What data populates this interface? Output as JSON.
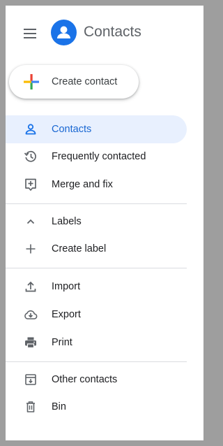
{
  "header": {
    "menu_icon": "hamburger-menu-icon",
    "logo_icon": "contacts-person-icon",
    "title": "Contacts"
  },
  "create_contact": {
    "label": "Create contact",
    "icon": "multicolor-plus-icon"
  },
  "nav": {
    "contacts": {
      "label": "Contacts",
      "icon": "person-outline-icon",
      "active": true
    },
    "frequently_contacted": {
      "label": "Frequently contacted",
      "icon": "history-icon"
    },
    "merge_and_fix": {
      "label": "Merge and fix",
      "icon": "merge-fix-icon"
    }
  },
  "labels_section": {
    "labels": {
      "label": "Labels",
      "icon": "chevron-up-icon"
    },
    "create_label": {
      "label": "Create label",
      "icon": "plus-icon"
    }
  },
  "actions": {
    "import": {
      "label": "Import",
      "icon": "upload-icon"
    },
    "export": {
      "label": "Export",
      "icon": "cloud-download-icon"
    },
    "print": {
      "label": "Print",
      "icon": "printer-icon"
    }
  },
  "other": {
    "other_contacts": {
      "label": "Other contacts",
      "icon": "archive-icon"
    },
    "bin": {
      "label": "Bin",
      "icon": "trash-icon"
    }
  },
  "colors": {
    "accent": "#1a73e8",
    "active_bg": "#e8f0fe",
    "active_text": "#1967d2",
    "icon": "#5f6368",
    "text": "#202124",
    "divider": "#dadce0",
    "backdrop": "#9e9e9e"
  }
}
